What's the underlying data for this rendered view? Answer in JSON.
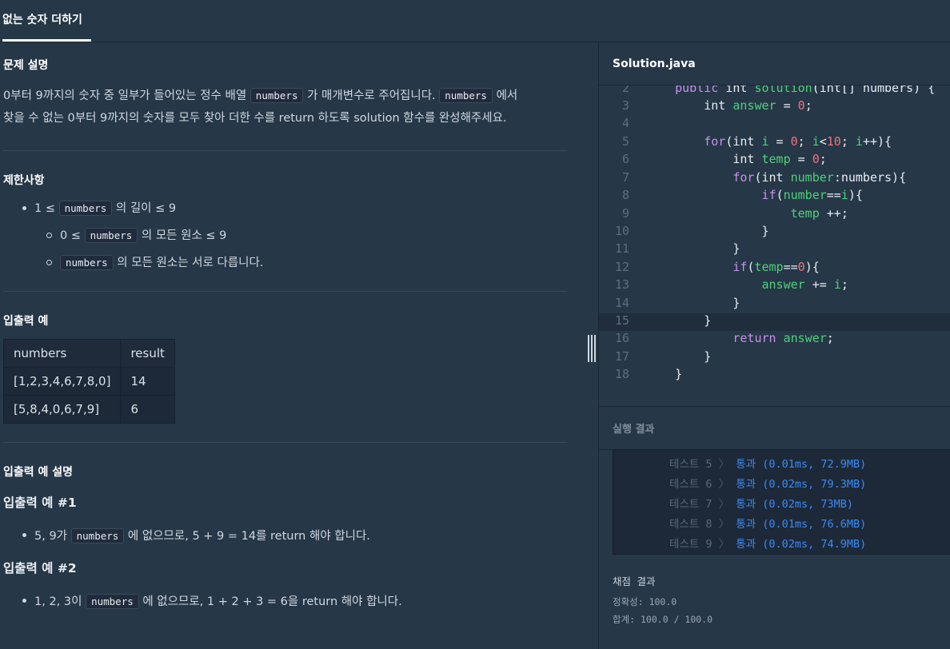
{
  "tab": {
    "title": "없는 숫자 더하기"
  },
  "description": {
    "heading": "문제 설명",
    "line1_a": "0부터 9까지의 숫자 중 일부가 들어있는 정수 배열",
    "code": "numbers",
    "line1_b": "가 매개변수로 주어집니다.",
    "line1_c": "에서",
    "line2": "찾을 수 없는 0부터 9까지의 숫자를 모두 찾아 더한 수를 return 하도록 solution 함수를 완성해주세요."
  },
  "constraints": {
    "heading": "제한사항",
    "item1_pre": "1 ≤",
    "item1_post": "의 길이 ≤ 9",
    "sub1_pre": "0 ≤",
    "sub1_post": "의 모든 원소 ≤ 9",
    "sub2_post": "의 모든 원소는 서로 다릅니다."
  },
  "io": {
    "heading": "입출력 예",
    "headers": [
      "numbers",
      "result"
    ],
    "rows": [
      [
        "[1,2,3,4,6,7,8,0]",
        "14"
      ],
      [
        "[5,8,4,0,6,7,9]",
        "6"
      ]
    ]
  },
  "explain": {
    "heading": "입출력 예 설명",
    "ex1_title": "입출력 예 #1",
    "ex1_pre": "5, 9가",
    "ex1_post": "에 없으므로, 5 + 9 = 14를 return 해야 합니다.",
    "ex2_title": "입출력 예 #2",
    "ex2_pre": "1, 2, 3이",
    "ex2_post": "에 없으므로, 1 + 2 + 3 = 6을 return 해야 합니다."
  },
  "editor": {
    "filename": "Solution.java",
    "line_numbers": [
      "2",
      "3",
      "4",
      "5",
      "6",
      "7",
      "8",
      "9",
      "10",
      "11",
      "12",
      "13",
      "14",
      "15",
      "16",
      "17",
      "18"
    ]
  },
  "results": {
    "heading": "실행 결과",
    "rows": [
      {
        "label": "테스트 5",
        "status": "통과 (0.01ms, 72.9MB)"
      },
      {
        "label": "테스트 6",
        "status": "통과 (0.02ms, 79.3MB)"
      },
      {
        "label": "테스트 7",
        "status": "통과 (0.02ms, 73MB)"
      },
      {
        "label": "테스트 8",
        "status": "통과 (0.01ms, 76.6MB)"
      },
      {
        "label": "테스트 9",
        "status": "통과 (0.02ms, 74.9MB)"
      }
    ],
    "grade_title": "채점 결과",
    "accuracy": "정확성: 100.0",
    "total": "합계: 100.0 / 100.0"
  },
  "colors": {
    "background": "#263747",
    "pass": "#3b8af5",
    "keyword": "#c792ea",
    "variable": "#4fd17b",
    "number": "#f07178"
  }
}
